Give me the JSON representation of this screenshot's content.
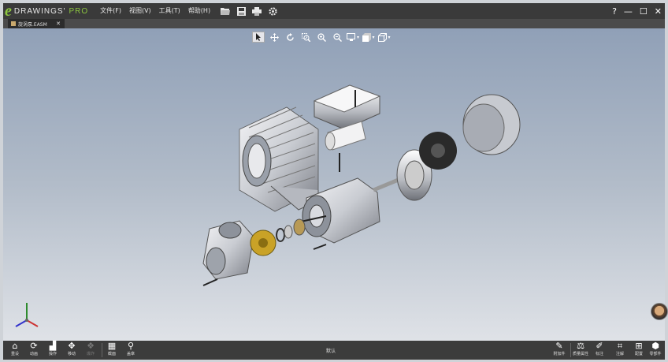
{
  "app": {
    "logo_e": "e",
    "brand": "DRAWINGS'",
    "pro": "PRO",
    "accent_color": "#8cc63f"
  },
  "menu": [
    {
      "label": "文件(F)"
    },
    {
      "label": "视图(V)"
    },
    {
      "label": "工具(T)"
    },
    {
      "label": "帮助(H)"
    }
  ],
  "quick_access": [
    "open-icon",
    "save-icon",
    "print-icon",
    "settings-icon"
  ],
  "window_controls": {
    "help": "?",
    "minimize": "—",
    "restore": "☐",
    "close": "✕"
  },
  "tab": {
    "label": "旋涡泵.EASM",
    "close": "✕"
  },
  "view_toolbar": [
    "select-icon",
    "pan-icon",
    "rotate-icon",
    "zoom-box-icon",
    "zoom-in-icon",
    "zoom-out-icon",
    "display-style-icon",
    "view-orientation-icon",
    "section-view-icon"
  ],
  "bottom_left": [
    {
      "icon": "home-icon",
      "label": "重设"
    },
    {
      "icon": "animate-icon",
      "label": "动画"
    },
    {
      "icon": "operate-icon",
      "label": "操作"
    },
    {
      "icon": "move-icon",
      "label": "移动"
    },
    {
      "icon": "explode-icon",
      "label": "爆炸",
      "disabled": true
    },
    {
      "icon": "section-icon",
      "label": "截面"
    },
    {
      "icon": "stamp-icon",
      "label": "盖章"
    }
  ],
  "status": "默认",
  "bottom_right": [
    {
      "icon": "attach-icon",
      "label": "附加件"
    },
    {
      "icon": "mass-icon",
      "label": "质量属性"
    },
    {
      "icon": "markup-icon",
      "label": "标注"
    },
    {
      "icon": "annotation-icon",
      "label": "注解"
    },
    {
      "icon": "config-icon",
      "label": "配置"
    },
    {
      "icon": "component-icon",
      "label": "零部件"
    }
  ]
}
